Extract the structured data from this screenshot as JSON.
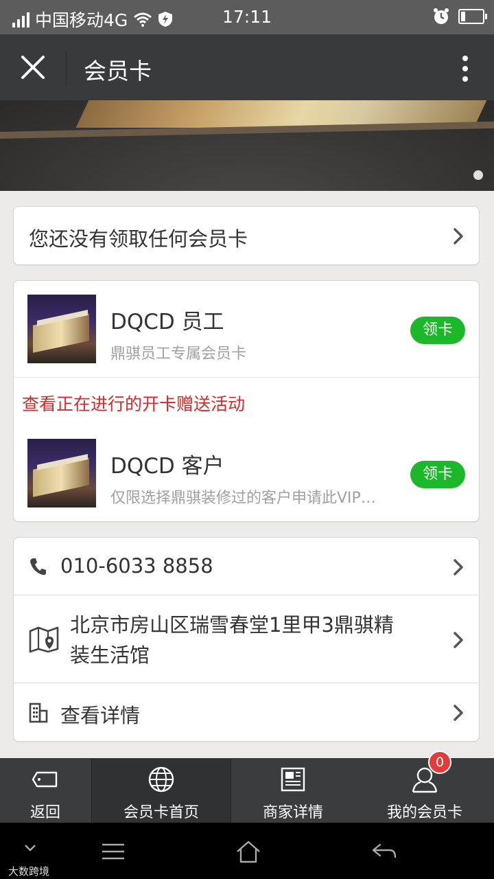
{
  "status_bar": {
    "carrier": "中国移动4G",
    "time": "17:11"
  },
  "title_bar": {
    "title": "会员卡"
  },
  "no_card_prompt": "您还没有领取任何会员卡",
  "cards": [
    {
      "name": "DQCD 员工",
      "description": "鼎骐员工专属会员卡",
      "button": "领卡"
    },
    {
      "name": "DQCD 客户",
      "description": "仅限选择鼎骐装修过的客户申请此VIP…",
      "button": "领卡"
    }
  ],
  "promo_link": "查看正在进行的开卡赠送活动",
  "store_info": {
    "phone": "010-6033 8858",
    "address_line1": "北京市房山区瑞雪春堂1里甲3鼎骐精",
    "address_line2": "装生活馆",
    "details": "查看详情"
  },
  "tab_bar": {
    "tabs": [
      {
        "label": "返回",
        "icon": "ticket-icon"
      },
      {
        "label": "会员卡首页",
        "icon": "globe-icon"
      },
      {
        "label": "商家详情",
        "icon": "newspaper-icon"
      },
      {
        "label": "我的会员卡",
        "icon": "user-icon"
      }
    ],
    "badge_count": "0"
  },
  "watermark": "大数跨境",
  "colors": {
    "accent_green": "#1db72a",
    "promo_red": "#d42a2a",
    "title_bar": "#383a3b",
    "badge_red": "#e23b3b"
  }
}
